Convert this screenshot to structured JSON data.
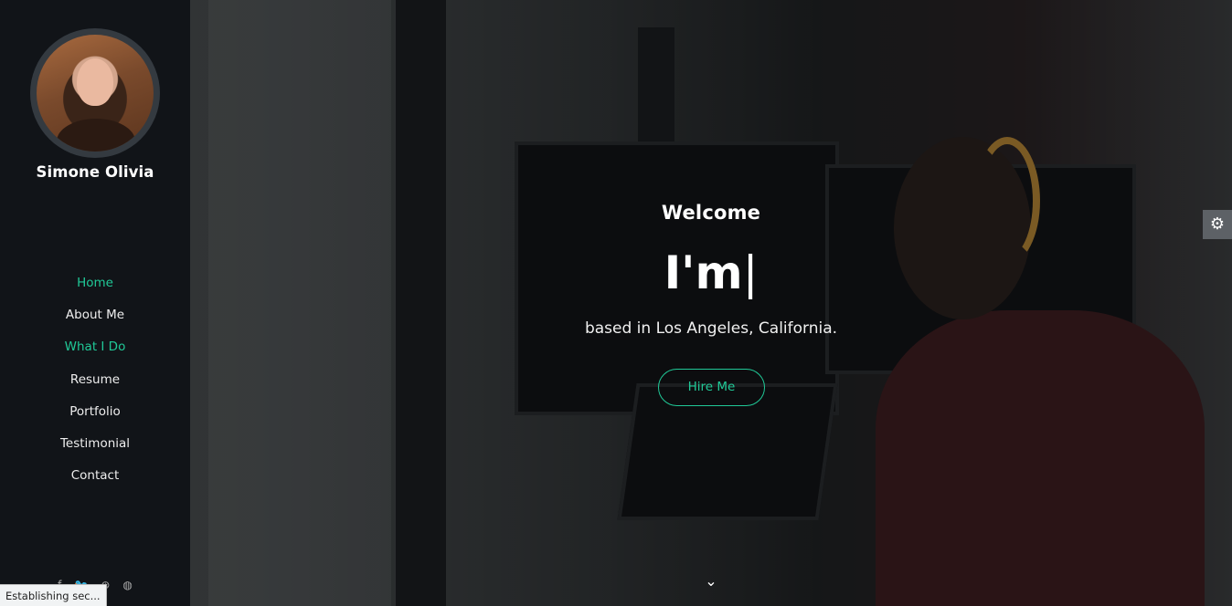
{
  "sidebar": {
    "profile_name": "Simone Olivia",
    "avatar_icon": "profile-photo",
    "nav": [
      {
        "label": "Home",
        "active": true
      },
      {
        "label": "About Me",
        "active": false
      },
      {
        "label": "What I Do",
        "active": true
      },
      {
        "label": "Resume",
        "active": false
      },
      {
        "label": "Portfolio",
        "active": false
      },
      {
        "label": "Testimonial",
        "active": false
      },
      {
        "label": "Contact",
        "active": false
      }
    ],
    "socials": [
      {
        "icon": "facebook-icon",
        "glyph": "f"
      },
      {
        "icon": "twitter-icon",
        "glyph": "🐦"
      },
      {
        "icon": "dribbble-icon",
        "glyph": "⊛"
      },
      {
        "icon": "github-icon",
        "glyph": "◍"
      }
    ]
  },
  "hero": {
    "welcome": "Welcome",
    "headline": "I'm",
    "cursor": "|",
    "location": "based in Los Angeles, California.",
    "hire_button": "Hire Me",
    "scroll_icon": "chevron-down-icon",
    "scroll_glyph": "⌄"
  },
  "settings": {
    "icon": "gear-icon",
    "glyph": "⚙"
  },
  "status_bar": {
    "text": "Establishing sec..."
  },
  "colors": {
    "accent": "#20c997",
    "sidebar_bg": "#111418"
  }
}
